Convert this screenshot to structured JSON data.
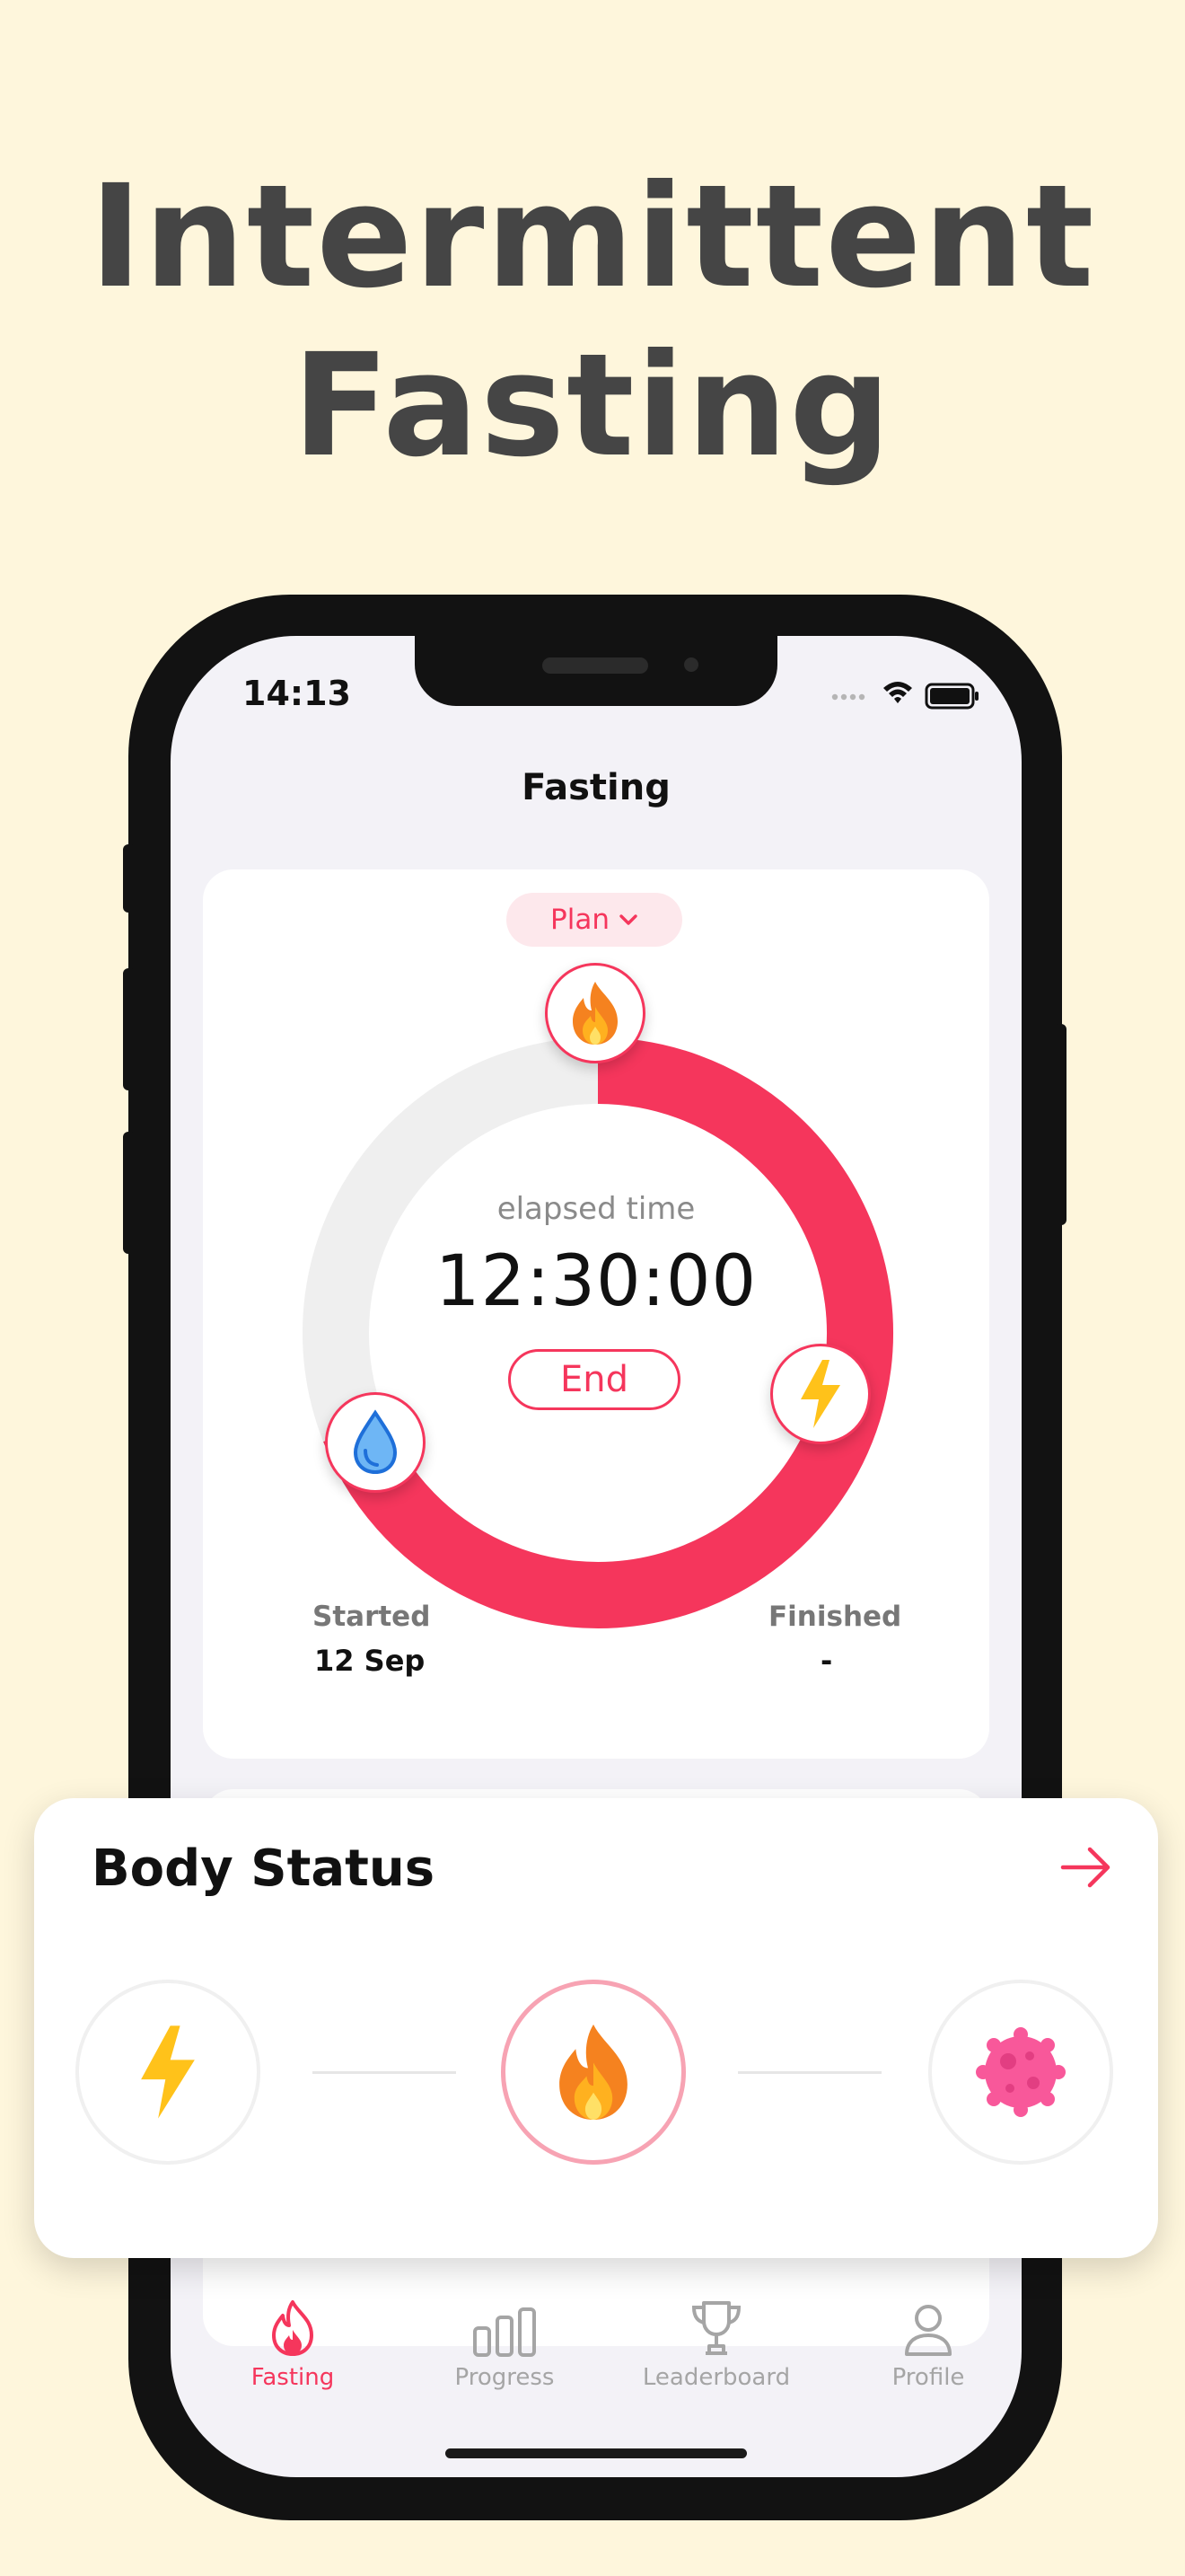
{
  "headline": {
    "line1": "Intermittent",
    "line2": "Fasting"
  },
  "status_bar": {
    "time": "14:13"
  },
  "nav": {
    "title": "Fasting"
  },
  "timer_card": {
    "plan_label": "Plan",
    "elapsed_label": "elapsed time",
    "elapsed_time": "12:30:00",
    "end_label": "End",
    "progress_fraction": 0.69,
    "started_label": "Started",
    "started_value": "12 Sep",
    "finished_label": "Finished",
    "finished_value": "-"
  },
  "body_status": {
    "title": "Body Status",
    "stages": [
      {
        "icon": "lightning-icon",
        "active": false
      },
      {
        "icon": "flame-icon",
        "active": true
      },
      {
        "icon": "cell-icon",
        "active": false
      }
    ]
  },
  "tabs": [
    {
      "label": "Fasting",
      "icon": "flame-tab-icon",
      "active": true
    },
    {
      "label": "Progress",
      "icon": "bar-chart-icon",
      "active": false
    },
    {
      "label": "Leaderboard",
      "icon": "trophy-icon",
      "active": false
    },
    {
      "label": "Profile",
      "icon": "person-icon",
      "active": false
    }
  ],
  "colors": {
    "background": "#FEF6DC",
    "accent": "#F5365C",
    "headline": "#454545",
    "ring_track": "#EFEFEF"
  }
}
